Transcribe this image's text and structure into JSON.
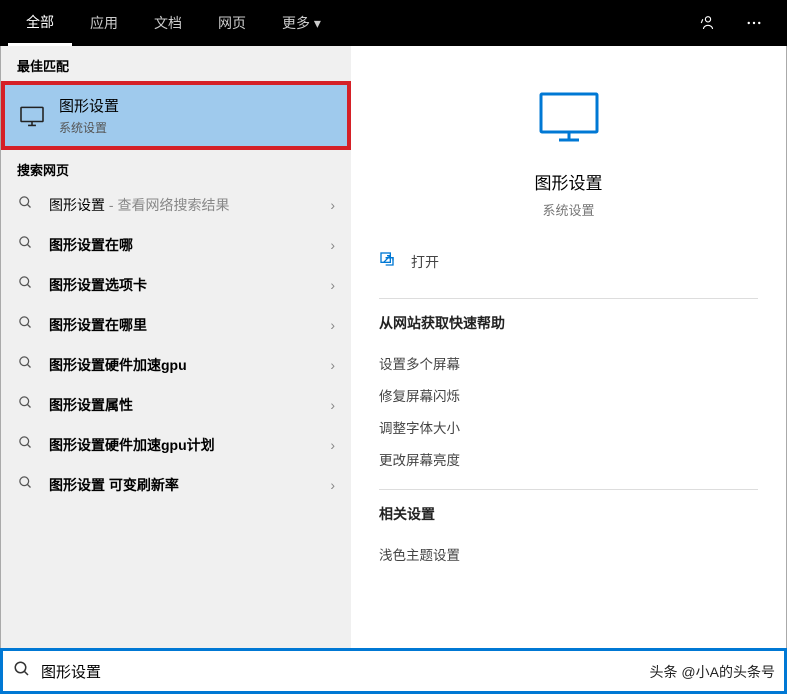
{
  "topbar": {
    "tabs": [
      "全部",
      "应用",
      "文档",
      "网页",
      "更多"
    ],
    "dropdown_glyph": "▾"
  },
  "left": {
    "best_match_header": "最佳匹配",
    "best_match": {
      "title": "图形设置",
      "subtitle": "系统设置"
    },
    "web_header": "搜索网页",
    "items": [
      {
        "text": "图形设置",
        "hint": " - 查看网络搜索结果"
      },
      {
        "text": "图形设置在哪"
      },
      {
        "text": "图形设置选项卡"
      },
      {
        "text": "图形设置在哪里"
      },
      {
        "text": "图形设置硬件加速gpu"
      },
      {
        "text": "图形设置属性"
      },
      {
        "text": "图形设置硬件加速gpu计划"
      },
      {
        "text": "图形设置 可变刷新率"
      }
    ]
  },
  "right": {
    "title": "图形设置",
    "subtitle": "系统设置",
    "open_label": "打开",
    "help_header": "从网站获取快速帮助",
    "help_links": [
      "设置多个屏幕",
      "修复屏幕闪烁",
      "调整字体大小",
      "更改屏幕亮度"
    ],
    "related_header": "相关设置",
    "related_links": [
      "浅色主题设置"
    ]
  },
  "searchbar": {
    "value": "图形设置"
  },
  "watermark": "头条 @小A的头条号",
  "colors": {
    "accent": "#0078d4",
    "highlight_border": "#d52027",
    "selected_bg": "#9fcaed"
  }
}
